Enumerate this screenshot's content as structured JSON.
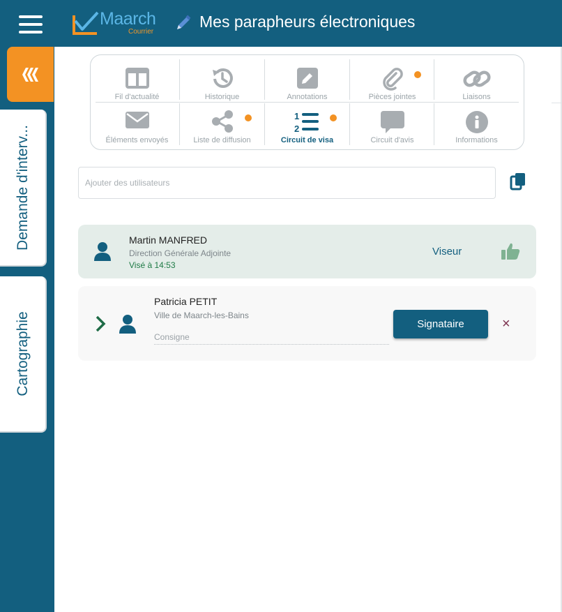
{
  "app": {
    "logo_name": "Maarch",
    "logo_sub": "Courrier",
    "title": "Mes parapheurs électroniques",
    "brand_color": "#135f7f",
    "accent_color": "#f39223"
  },
  "leftrail": {
    "active_icon": "stack-icon",
    "tabs": [
      {
        "label": "Demande d'interv..."
      },
      {
        "label": "Cartographie"
      }
    ]
  },
  "tabs": [
    {
      "label": "Fil d'actualité",
      "icon": "columns-icon",
      "active": false,
      "dot": false
    },
    {
      "label": "Historique",
      "icon": "history-icon",
      "active": false,
      "dot": false
    },
    {
      "label": "Annotations",
      "icon": "annotation-pencil-icon",
      "active": false,
      "dot": false
    },
    {
      "label": "Pièces jointes",
      "icon": "paperclip-icon",
      "active": false,
      "dot": true
    },
    {
      "label": "Liaisons",
      "icon": "link-icon",
      "active": false,
      "dot": false
    },
    {
      "label": "Éléments envoyés",
      "icon": "envelope-icon",
      "active": false,
      "dot": false
    },
    {
      "label": "Liste de diffusion",
      "icon": "share-icon",
      "active": false,
      "dot": true
    },
    {
      "label": "Circuit de visa",
      "icon": "numbered-list-icon",
      "active": true,
      "dot": true
    },
    {
      "label": "Circuit d'avis",
      "icon": "comment-icon",
      "active": false,
      "dot": false
    },
    {
      "label": "Informations",
      "icon": "info-icon",
      "active": false,
      "dot": false
    }
  ],
  "add_users": {
    "placeholder": "Ajouter des utilisateurs"
  },
  "visa_circuit": [
    {
      "name": "Martin MANFRED",
      "org": "Direction Générale Adjointe",
      "status": "Visé à 14:53",
      "role": "Viseur"
    },
    {
      "name": "Patricia PETIT",
      "org": "Ville de Maarch-les-Bains",
      "consigne_placeholder": "Consigne",
      "role": "Signataire"
    }
  ]
}
